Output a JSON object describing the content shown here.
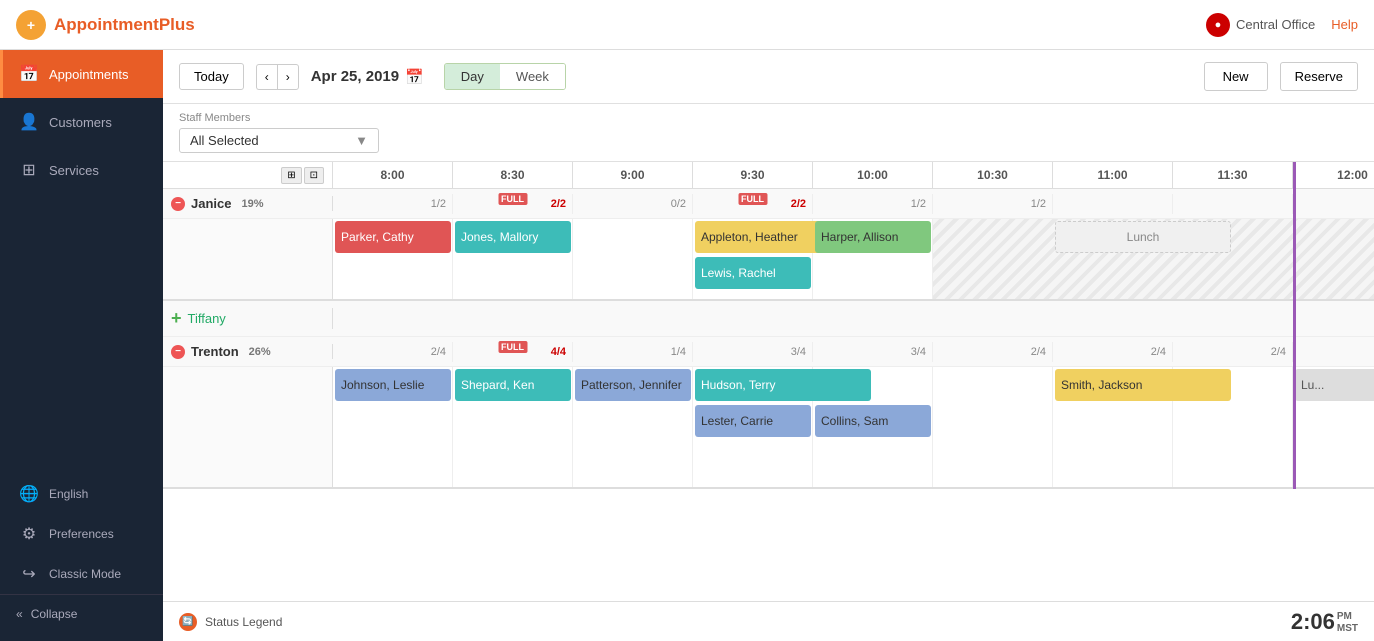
{
  "brand": {
    "name": "AppointmentPlus",
    "name_part1": "Appointment",
    "name_part2": "Plus"
  },
  "top_nav": {
    "central_office_label": "Central Office",
    "help_label": "Help"
  },
  "toolbar": {
    "today_label": "Today",
    "date": "Apr 25, 2019",
    "view_day_label": "Day",
    "view_week_label": "Week",
    "new_label": "New",
    "reserve_label": "Reserve"
  },
  "staff_filter": {
    "label": "Staff Members",
    "value": "All Selected"
  },
  "time_slots": [
    "8:00",
    "8:30",
    "9:00",
    "9:30",
    "10:00",
    "10:30",
    "11:00",
    "11:30",
    "12:00"
  ],
  "staff": [
    {
      "name": "Janice",
      "pct": "19%",
      "type": "collapsed",
      "capacities": [
        "1/2",
        "2/2",
        "0/2",
        "2/2",
        "1/2",
        "1/2",
        "",
        "",
        ""
      ],
      "full_slots": [
        1,
        3
      ],
      "appointments": [
        {
          "name": "Parker, Cathy",
          "slot": 0,
          "color": "red",
          "row": 0
        },
        {
          "name": "Jones, Mallory",
          "slot": 1,
          "color": "teal",
          "row": 0
        },
        {
          "name": "Appleton, Heather",
          "slot": 3,
          "color": "yellow",
          "span": 1.5,
          "row": 0
        },
        {
          "name": "Lewis, Rachel",
          "slot": 3,
          "color": "teal",
          "row": 1
        },
        {
          "name": "Harper, Allison",
          "slot": 4,
          "color": "green-light",
          "row": 0
        },
        {
          "name": "Lunch",
          "slot": 6,
          "color": "lunch",
          "span": 1.5,
          "row": 0
        }
      ]
    },
    {
      "name": "Tiffany",
      "type": "add",
      "pct": ""
    },
    {
      "name": "Trenton",
      "pct": "26%",
      "type": "collapsed",
      "capacities": [
        "2/4",
        "4/4",
        "1/4",
        "3/4",
        "3/4",
        "2/4",
        "2/4",
        "2/4",
        ""
      ],
      "full_slots": [
        1
      ],
      "appointments": [
        {
          "name": "Johnson, Leslie",
          "slot": 0,
          "color": "blue-light",
          "row": 0
        },
        {
          "name": "Shepard, Ken",
          "slot": 1,
          "color": "teal",
          "row": 0
        },
        {
          "name": "Patterson, Jennifer",
          "slot": 2,
          "color": "blue-light",
          "row": 0
        },
        {
          "name": "Hudson, Terry",
          "slot": 3,
          "color": "teal",
          "span": 1.5,
          "row": 0
        },
        {
          "name": "Lester, Carrie",
          "slot": 3,
          "color": "blue-light",
          "row": 1
        },
        {
          "name": "Collins, Sam",
          "slot": 4,
          "color": "blue-light",
          "row": 1
        },
        {
          "name": "Smith, Jackson",
          "slot": 6,
          "color": "yellow",
          "span": 1.5,
          "row": 0
        },
        {
          "name": "Lu...",
          "slot": 8,
          "color": "gray",
          "row": 0
        }
      ]
    }
  ],
  "status_bar": {
    "legend_label": "Status Legend",
    "time": "2:06",
    "time_pm": "PM",
    "time_tz": "MST"
  }
}
